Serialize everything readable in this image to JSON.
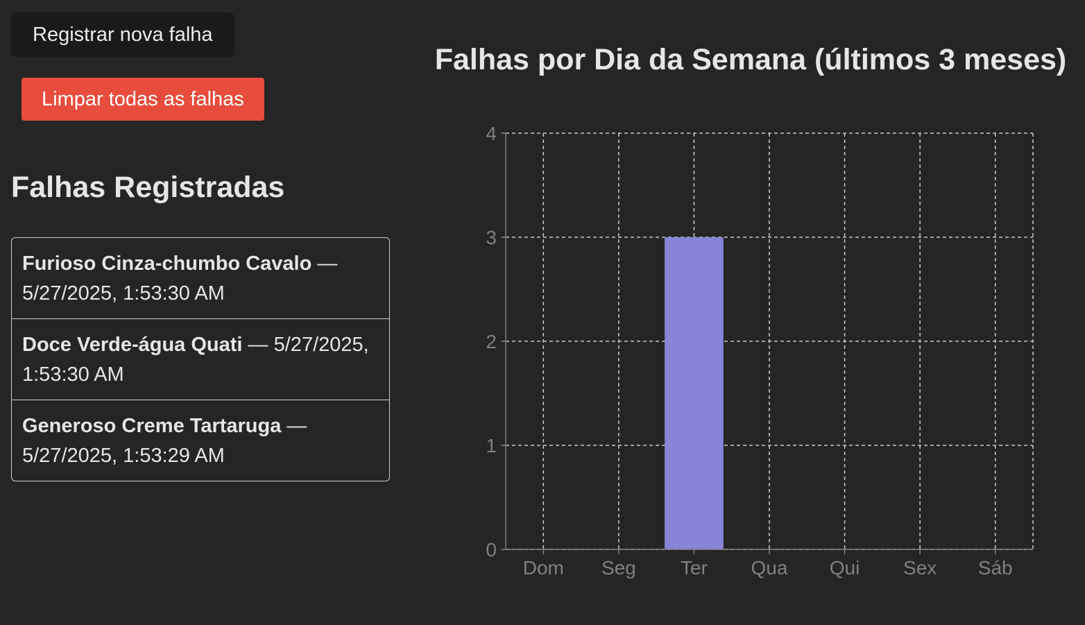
{
  "buttons": {
    "register_label": "Registrar nova falha",
    "clear_label": "Limpar todas as falhas"
  },
  "list": {
    "title": "Falhas Registradas",
    "items": [
      {
        "name": "Furioso Cinza-chumbo Cavalo",
        "separator": " — ",
        "timestamp": "5/27/2025, 1:53:30 AM"
      },
      {
        "name": "Doce Verde-água Quati",
        "separator": " — ",
        "timestamp": "5/27/2025, 1:53:30 AM"
      },
      {
        "name": "Generoso Creme Tartaruga",
        "separator": " — ",
        "timestamp": "5/27/2025, 1:53:29 AM"
      }
    ]
  },
  "colors": {
    "background": "#252525",
    "clear_button": "#e74c3c",
    "bar": "#8884d8",
    "grid": "#cccccc",
    "axis_text": "#808080"
  },
  "chart_data": {
    "type": "bar",
    "title": "Falhas por Dia da Semana (últimos 3 meses)",
    "categories": [
      "Dom",
      "Seg",
      "Ter",
      "Qua",
      "Qui",
      "Sex",
      "Sáb"
    ],
    "values": [
      0,
      0,
      3,
      0,
      0,
      0,
      0
    ],
    "ylim": [
      0,
      4
    ],
    "yticks": [
      0,
      1,
      2,
      3,
      4
    ],
    "grid": true,
    "xlabel": "",
    "ylabel": ""
  }
}
